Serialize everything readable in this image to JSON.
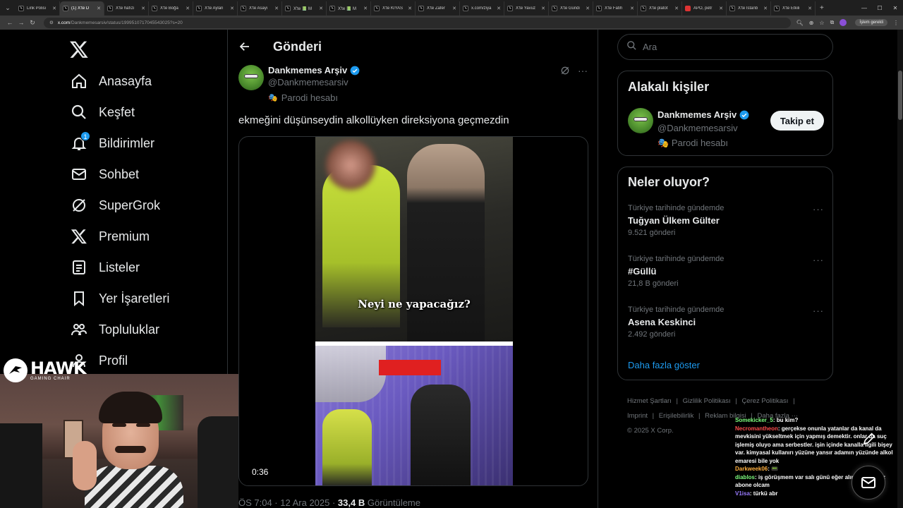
{
  "browser": {
    "tabs": [
      {
        "label": "Link Polisi",
        "active": false
      },
      {
        "label": "(1) X'te D",
        "active": true
      },
      {
        "label": "X'te hafızı",
        "active": false
      },
      {
        "label": "X'te Boğa",
        "active": false
      },
      {
        "label": "X'te Aylan",
        "active": false
      },
      {
        "label": "X'te Asayı",
        "active": false
      },
      {
        "label": "X'te 📗 M",
        "active": false
      },
      {
        "label": "X'te 📗 M",
        "active": false
      },
      {
        "label": "X'te KIYAS",
        "active": false
      },
      {
        "label": "X'te Zafer",
        "active": false
      },
      {
        "label": "x.com/ziya",
        "active": false
      },
      {
        "label": "X'te Yavuz",
        "active": false
      },
      {
        "label": "X'te Gündi",
        "active": false
      },
      {
        "label": "X'te Fatih",
        "active": false
      },
      {
        "label": "X'te platot",
        "active": false
      },
      {
        "label": "APO, petr",
        "active": false
      },
      {
        "label": "X'te İstanb",
        "active": false
      },
      {
        "label": "X'te Etkili",
        "active": false
      }
    ],
    "url_site": "x.com",
    "url_path": "/Dankmemesarsiv/status/1999510717045543025?s=20",
    "profile_label": "İşlem gerekli"
  },
  "nav": {
    "items": [
      {
        "label": "Anasayfa",
        "icon": "home-icon"
      },
      {
        "label": "Keşfet",
        "icon": "search-icon"
      },
      {
        "label": "Bildirimler",
        "icon": "bell-icon",
        "badge": "1"
      },
      {
        "label": "Sohbet",
        "icon": "mail-icon"
      },
      {
        "label": "SuperGrok",
        "icon": "grok-icon"
      },
      {
        "label": "Premium",
        "icon": "x-icon"
      },
      {
        "label": "Listeler",
        "icon": "list-icon"
      },
      {
        "label": "Yer İşaretleri",
        "icon": "bookmark-icon"
      },
      {
        "label": "Topluluklar",
        "icon": "communities-icon"
      },
      {
        "label": "Profil",
        "icon": "profile-icon"
      }
    ]
  },
  "main": {
    "title": "Gönderi",
    "post": {
      "author_name": "Dankmemes Arşiv",
      "author_handle": "@Dankmemesarsiv",
      "parody_label": "Parodi hesabı",
      "text": "ekmeğini düşünseydin alkollüyken direksiyona geçmezdin",
      "video_caption": "Neyi ne yapacağız?",
      "duration": "0:36",
      "time": "ÖS 7:04 · 12 Ara 2025 · ",
      "views": "33,4 B",
      "views_label": " Görüntüleme"
    }
  },
  "sidebar": {
    "search_placeholder": "Ara",
    "related": {
      "title": "Alakalı kişiler",
      "name": "Dankmemes Arşiv",
      "handle": "@Dankmemesarsiv",
      "parody": "Parodi hesabı",
      "follow_label": "Takip et"
    },
    "trends": {
      "title": "Neler oluyor?",
      "items": [
        {
          "context": "Türkiye tarihinde gündemde",
          "name": "Tuğyan Ülkem Gülter",
          "count": "9.521 gönderi"
        },
        {
          "context": "Türkiye tarihinde gündemde",
          "name": "#Güllü",
          "count": "21,8 B gönderi"
        },
        {
          "context": "Türkiye tarihinde gündemde",
          "name": "Asena Keskinci",
          "count": "2.492 gönderi"
        }
      ],
      "show_more": "Daha fazla göster"
    },
    "footer": {
      "terms": "Hizmet Şartları",
      "privacy": "Gizlilik Politikası",
      "cookies": "Çerez Politikası",
      "imprint": "Imprint",
      "accessibility": "Erişilebilirlik",
      "ads": "Reklam bilgisi",
      "more": "Daha fazla ···",
      "copyright": "© 2025 X Corp."
    }
  },
  "overlay": {
    "brand_title": "HAWK",
    "brand_subtitle": "GAMING CHAIR",
    "chat": [
      {
        "user": "Somekicker_5",
        "text": ": bu kim?"
      },
      {
        "user": "Necromantheon",
        "text": ": gerçekse onunla yatanlar da kanal da mevkisini yükseltmek için yapmış demektir. onlar da suç işlemiş oluyo ama serbestler. işin içinde kanalla ilgili bişey var. kimyasal kullanırı yüzüne yansır adamın yüzünde alkol emaresi bile yok"
      },
      {
        "user": "Darkweek06",
        "text": ": 📟"
      },
      {
        "user": "diablos",
        "text": ": iş görüşmem var salı günü eğer alırlarsa iyi söz abone olcam"
      },
      {
        "user": "V1isa",
        "text": ": türkü abr"
      }
    ]
  },
  "colors": {
    "accent": "#1d9bf0",
    "background": "#000000",
    "border": "#2f3336",
    "text_primary": "#e7e9ea",
    "text_secondary": "#71767b"
  }
}
